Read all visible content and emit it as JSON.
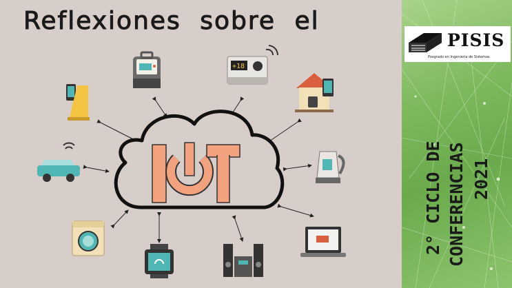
{
  "title": "Reflexiones sobre el",
  "iot_logo": "IoT",
  "sidebar": {
    "logo_name": "PISIS",
    "logo_subtitle": "Posgrado en Ingeniería de Sistemas",
    "line1": "2° CICLO DE",
    "line2": "CONFERENCIAS",
    "line3": "2021"
  },
  "thermostat_display": "+18",
  "colors": {
    "background": "#d8cec9",
    "panel_green": "#7cb85c",
    "iot_orange": "#f2a27e",
    "device_teal": "#4fb6b3",
    "device_yellow": "#f4c542"
  },
  "icons": [
    "coffee-maker-icon",
    "thermostat-icon",
    "smart-home-icon",
    "kettle-icon",
    "laptop-icon",
    "speaker-system-icon",
    "smartwatch-icon",
    "washing-machine-icon",
    "smart-car-icon",
    "smart-iron-icon",
    "cloud-icon",
    "power-icon"
  ]
}
